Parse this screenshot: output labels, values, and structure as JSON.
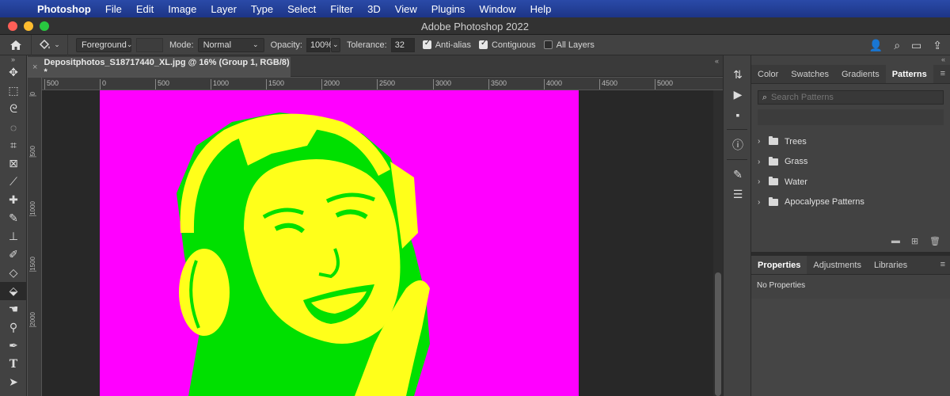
{
  "menubar": {
    "app": "Photoshop",
    "items": [
      "File",
      "Edit",
      "Image",
      "Layer",
      "Type",
      "Select",
      "Filter",
      "3D",
      "View",
      "Plugins",
      "Window",
      "Help"
    ]
  },
  "window": {
    "title": "Adobe Photoshop 2022"
  },
  "options": {
    "fill_source": "Foreground",
    "mode_label": "Mode:",
    "mode_value": "Normal",
    "opacity_label": "Opacity:",
    "opacity_value": "100%",
    "tolerance_label": "Tolerance:",
    "tolerance_value": "32",
    "antialias_label": "Anti-alias",
    "antialias_checked": true,
    "contiguous_label": "Contiguous",
    "contiguous_checked": true,
    "all_layers_label": "All Layers",
    "all_layers_checked": false
  },
  "document": {
    "tab_title": "Depositphotos_S18717440_XL.jpg @ 16% (Group 1, RGB/8) *",
    "ruler_h": [
      "500",
      "0",
      "500",
      "1000",
      "1500",
      "2000",
      "2500",
      "3000",
      "3500",
      "4000",
      "4500",
      "5000"
    ],
    "ruler_v": [
      "0",
      "500",
      "1000",
      "1500",
      "2000"
    ],
    "colors": {
      "background": "#ff00ff",
      "midtone": "#00e000",
      "highlight": "#ffff1a"
    }
  },
  "patterns_panel": {
    "tabs": [
      "Color",
      "Swatches",
      "Gradients",
      "Patterns"
    ],
    "active_tab": "Patterns",
    "search_placeholder": "Search Patterns",
    "folders": [
      "Trees",
      "Grass",
      "Water",
      "Apocalypse Patterns"
    ]
  },
  "properties_panel": {
    "tabs": [
      "Properties",
      "Adjustments",
      "Libraries"
    ],
    "active_tab": "Properties",
    "empty_text": "No Properties"
  }
}
